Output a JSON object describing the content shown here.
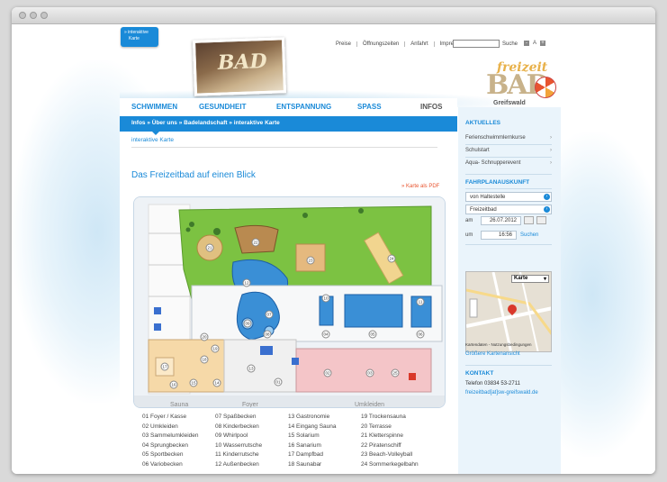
{
  "badge": {
    "line1": "» interaktive",
    "line2": "Karte"
  },
  "toplinks": [
    "Preise",
    "Öffnungszeiten",
    "Anfahrt",
    "Impressum"
  ],
  "search": {
    "label": "Suche",
    "value": ""
  },
  "fontsize": [
    "-",
    "A",
    "+"
  ],
  "brand": {
    "top": "freizeit",
    "main": "BAD",
    "sub": "Greifswald"
  },
  "photo_logo": "BAD",
  "nav": [
    {
      "label": "SCHWIMMEN",
      "active": true
    },
    {
      "label": "GESUNDHEIT",
      "active": false
    },
    {
      "label": "ENTSPANNUNG",
      "active": false
    },
    {
      "label": "SPASS",
      "active": false
    },
    {
      "label": "INFOS",
      "active": false
    }
  ],
  "breadcrumb": "Infos » Über uns » Badelandschaft » interaktive Karte",
  "subnav": "interaktive Karte",
  "page_title": "Das Freizeitbad auf einen Blick",
  "pdf_link": "» Karte als PDF",
  "map": {
    "sections": [
      "Sauna",
      "Foyer",
      "Umkleiden"
    ],
    "numbers": [
      "21",
      "22",
      "23",
      "24",
      "12",
      "07",
      "08",
      "09",
      "10",
      "11",
      "04",
      "05",
      "06",
      "20",
      "19",
      "18",
      "17",
      "16",
      "15",
      "14",
      "13",
      "01",
      "02",
      "03",
      "25"
    ]
  },
  "legend": [
    [
      "01  Foyer / Kasse",
      "07  Spaßbecken",
      "13  Gastronomie",
      "19  Trockensauna"
    ],
    [
      "02  Umkleiden",
      "08  Kinderbecken",
      "14  Eingang Sauna",
      "20  Terrasse"
    ],
    [
      "03  Sammelumkleiden",
      "09  Whirlpool",
      "15  Solarium",
      "21  Kletterspinne"
    ],
    [
      "04  Sprungbecken",
      "10  Wasserrutsche",
      "16  Sanarium",
      "22  Piratenschiff"
    ],
    [
      "05  Sportbecken",
      "11  Kinderrutsche",
      "17  Dampfbad",
      "23  Beach-Volleyball"
    ],
    [
      "06  Variobecken",
      "12  Außenbecken",
      "18  Saunabar",
      "24  Sommerkegelbahn"
    ]
  ],
  "sidebar": {
    "aktuelles_title": "AKTUELLES",
    "aktuelles": [
      "Ferienschwimmlernkurse",
      "Schulstart",
      "Aqua- Schnupperevent"
    ],
    "fahrplan_title": "FAHRPLANAUSKUNFT",
    "from_placeholder": "von Haltestelle",
    "to_value": "Freizeitbad",
    "am_label": "am",
    "date": "26.07.2012",
    "um_label": "um",
    "time": "16:56",
    "suchen": "Suchen",
    "map_type": "Karte",
    "map_footer": "Kartendaten - Nutzungsbedingungen",
    "bigger_map": "Größere Kartenansicht",
    "kontakt_title": "KONTAKT",
    "phone": "Telefon 03834 53-2711",
    "email": "freizeitbad[at]sw-greifswald.de"
  },
  "colors": {
    "accent": "#1a8ad8",
    "grass": "#7cc242",
    "pool": "#3a8fd6",
    "sauna": "#f6d9a8",
    "link_red": "#e8542f"
  }
}
